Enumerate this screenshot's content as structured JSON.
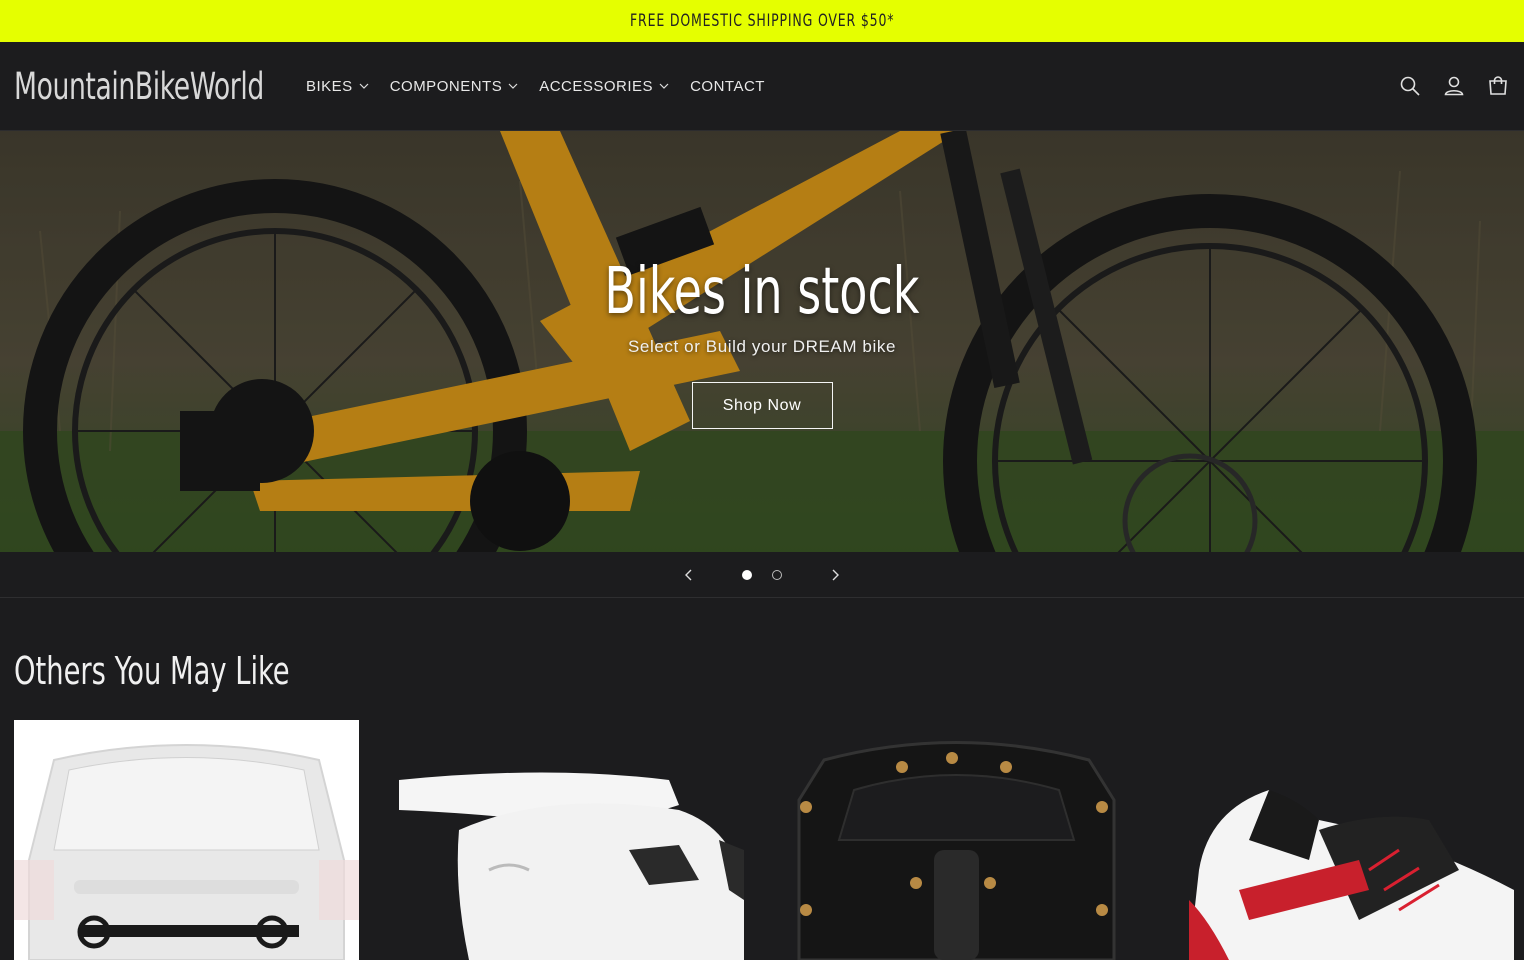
{
  "announcement": "FREE DOMESTIC SHIPPING OVER $50*",
  "header": {
    "logo": "MountainBikeWorld",
    "nav": [
      {
        "label": "BIKES",
        "dropdown": true
      },
      {
        "label": "COMPONENTS",
        "dropdown": true
      },
      {
        "label": "ACCESSORIES",
        "dropdown": true
      },
      {
        "label": "CONTACT",
        "dropdown": false
      }
    ],
    "icons": [
      "search-icon",
      "account-icon",
      "cart-icon"
    ]
  },
  "hero": {
    "title": "Bikes in stock",
    "subtitle": "Select or Build your DREAM bike",
    "button": "Shop Now",
    "slides": 2,
    "active_slide": 1
  },
  "section": {
    "title": "Others You May Like",
    "products": [
      "bike-rack",
      "helmet",
      "pedal",
      "shoe"
    ]
  },
  "colors": {
    "announce_bg": "#e5ff00",
    "page_bg": "#1c1c1e",
    "frame_accent": "#e8a21a"
  }
}
